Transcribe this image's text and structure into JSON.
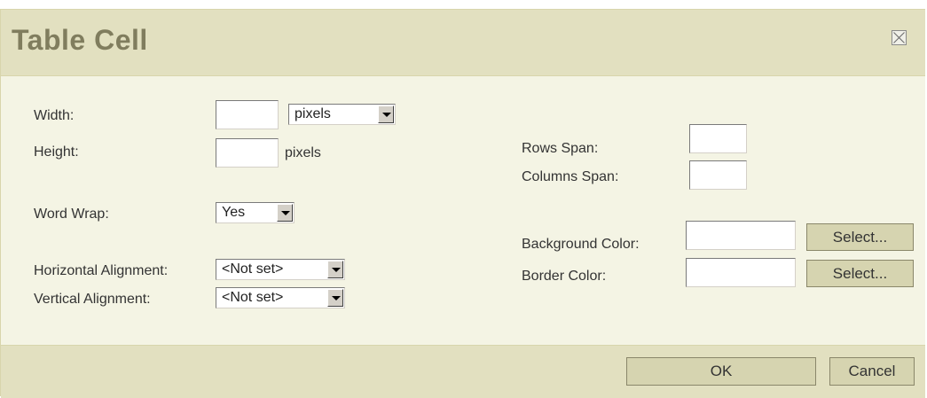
{
  "dialog": {
    "title": "Table Cell",
    "close_icon": "close-icon"
  },
  "form": {
    "width_label": "Width:",
    "width_value": "",
    "width_unit": "pixels",
    "height_label": "Height:",
    "height_value": "",
    "height_unit": "pixels",
    "word_wrap_label": "Word Wrap:",
    "word_wrap_value": "Yes",
    "h_align_label": "Horizontal Alignment:",
    "h_align_value": "<Not set>",
    "v_align_label": "Vertical Alignment:",
    "v_align_value": "<Not set>",
    "rows_span_label": "Rows Span:",
    "rows_span_value": "",
    "columns_span_label": "Columns Span:",
    "columns_span_value": "",
    "bg_color_label": "Background Color:",
    "bg_color_value": "",
    "bg_select_label": "Select...",
    "border_color_label": "Border Color:",
    "border_color_value": "",
    "border_select_label": "Select..."
  },
  "footer": {
    "ok_label": "OK",
    "cancel_label": "Cancel"
  },
  "colors": {
    "titlebar": "#e2e0c0",
    "title_text": "#807d5e",
    "body": "#f4f4e4",
    "button": "#d6d4b0"
  }
}
